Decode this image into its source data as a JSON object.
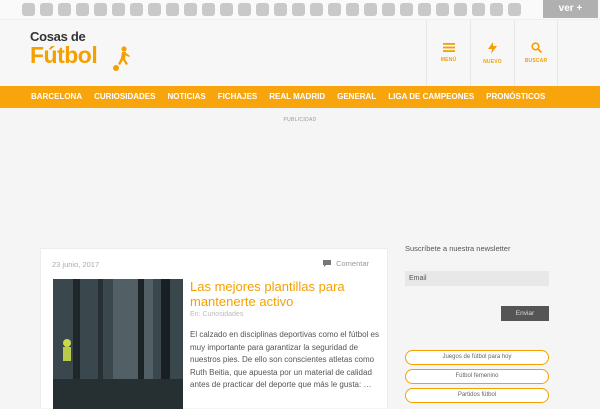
{
  "topbar": {
    "button_label": "ver +"
  },
  "logo": {
    "line1": "Cosas de",
    "line2": "Fútbol"
  },
  "header_buttons": [
    {
      "label": "MENÚ",
      "icon": "menu-icon"
    },
    {
      "label": "NUEVO",
      "icon": "lightning-icon"
    },
    {
      "label": "BUSCAR",
      "icon": "search-icon"
    }
  ],
  "nav": [
    "BARCELONA",
    "CURIOSIDADES",
    "NOTICIAS",
    "FICHAJES",
    "REAL MADRID",
    "GENERAL",
    "LIGA DE CAMPEONES",
    "PRONÓSTICOS"
  ],
  "ad_label": "PUBLICIDAD",
  "article": {
    "date": "23 junio, 2017",
    "comment_label": "Comentar",
    "title": "Las mejores plantillas para mantenerte activo",
    "category_prefix": "En:",
    "category": "Curiosidades",
    "excerpt": "El calzado en disciplinas deportivas como el fútbol es muy importante para garantizar la seguridad de nuestros pies. De ello son conscientes atletas como Ruth Beitia, que apuesta por un material de calidad antes de practicar del deporte que más le gusta: …"
  },
  "sidebar": {
    "newsletter_title": "Suscríbete a nuestra newsletter",
    "email_placeholder": "Email",
    "send_label": "Enviar",
    "tags": [
      "Juegos de fútbol para hoy",
      "Fútbol femenino",
      "Partidos fútbol"
    ]
  },
  "colors": {
    "accent": "#f5a000",
    "nav_bg": "#f8a50d"
  }
}
